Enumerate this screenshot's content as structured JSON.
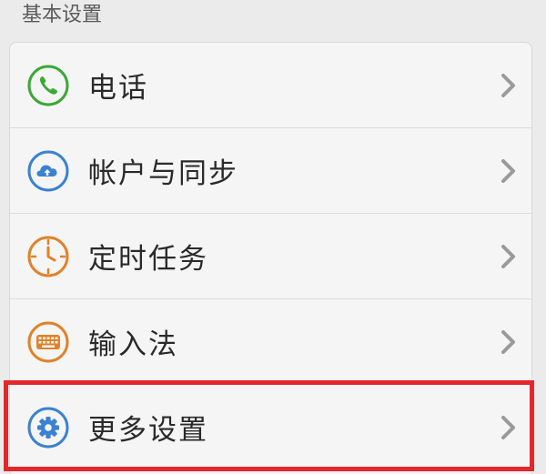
{
  "section": {
    "title": "基本设置"
  },
  "rows": [
    {
      "label": "电话",
      "icon": "phone-icon",
      "color": "#3aa935"
    },
    {
      "label": "帐户与同步",
      "icon": "cloud-upload-icon",
      "color": "#3b82d0"
    },
    {
      "label": "定时任务",
      "icon": "clock-icon",
      "color": "#e0822a"
    },
    {
      "label": "输入法",
      "icon": "keyboard-icon",
      "color": "#e0822a"
    },
    {
      "label": "更多设置",
      "icon": "gear-icon",
      "color": "#3b82d0"
    }
  ],
  "colors": {
    "background": "#ebebeb",
    "card": "#f5f5f5",
    "highlight": "#e5262b",
    "chevron": "#9a9a9a"
  }
}
